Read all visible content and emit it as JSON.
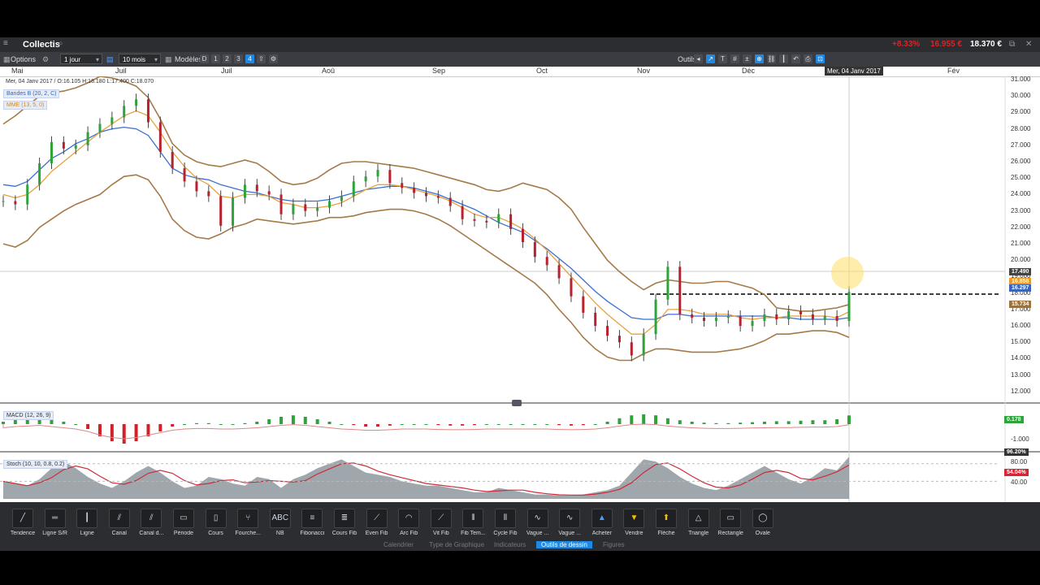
{
  "app": {
    "title": "Collectis",
    "quote": {
      "change": "+8.33%",
      "previous": "16.955 €",
      "last": "18.370 €"
    }
  },
  "toolbar": {
    "options_label": "Options",
    "interval": "1 jour",
    "period": "10 mois",
    "modeles_label": "Modèles",
    "range_buttons": [
      "D",
      "1",
      "2",
      "3",
      "4"
    ],
    "outils_label": "Outils"
  },
  "months": [
    "Mai",
    "Juil",
    "Juil",
    "Aoû",
    "Sep",
    "Oct",
    "Nov",
    "Déc",
    "Fév"
  ],
  "cursor_date": "Mer, 04 Janv 2017",
  "ohlc": "Mer, 04 Janv 2017 / O:16.105 H:18.180 L:17.400 C:18.070",
  "indicators": {
    "bollinger": "Bandes B (20, 2, C)",
    "mme": "MME (13, 5, 0)",
    "macd": "MACD (12, 26, 9)",
    "stoch": "Stoch (10, 10, 0.8, 0.2)"
  },
  "price_axis": [
    "31.000",
    "30.000",
    "29.000",
    "28.000",
    "27.000",
    "26.000",
    "25.000",
    "24.000",
    "23.000",
    "22.000",
    "21.000",
    "20.000",
    "19.000",
    "18.000",
    "17.000",
    "16.000",
    "15.000",
    "14.000",
    "13.000",
    "12.000"
  ],
  "price_tags": {
    "last": "17.490",
    "ema": "16.858",
    "mid": "16.297",
    "lower": "15.734"
  },
  "macd_axis": {
    "value": "0.178",
    "low": "-1.000"
  },
  "stoch_axis": {
    "top": "96.20%",
    "upper": "80.00",
    "value": "54.04%",
    "lower": "40.00"
  },
  "tools": [
    "Tendence",
    "Ligne S/R",
    "Ligne",
    "Canal",
    "Canal d...",
    "Période",
    "Cours",
    "Fourche...",
    "NB",
    "Fibonacci",
    "Cours Fib",
    "Even Fib",
    "Arc Fib",
    "Vit Fib",
    "Fib Tem...",
    "Cycle Fib",
    "Vague ...",
    "Vague ...",
    "Acheter",
    "Vendre",
    "Flèche",
    "Triangle",
    "Rectangle",
    "Ovale"
  ],
  "tool_icons": [
    "trend-line-icon",
    "sr-line-icon",
    "line-icon",
    "channel-icon",
    "channel-d-icon",
    "period-icon",
    "price-icon",
    "pitchfork-icon",
    "text-icon",
    "fibonacci-icon",
    "fib-price-icon",
    "fib-even-icon",
    "fib-arc-icon",
    "fib-speed-icon",
    "fib-time-icon",
    "fib-cycle-icon",
    "wave-icon",
    "wave2-icon",
    "buy-arrow-icon",
    "sell-arrow-icon",
    "arrow-icon",
    "triangle-icon",
    "rectangle-icon",
    "ellipse-icon"
  ],
  "tabs": [
    "Calendrier",
    "Type de Graphique",
    "Indicateurs",
    "Outils de dessin",
    "Figures"
  ],
  "active_tab": "Outils de dessin",
  "chart_data": {
    "type": "candlestick",
    "ylim": [
      11.5,
      31.0
    ],
    "close": [
      23.6,
      23.4,
      24.6,
      25.9,
      27.2,
      26.8,
      27.0,
      27.8,
      28.3,
      28.7,
      29.4,
      29.8,
      28.4,
      26.6,
      25.6,
      24.8,
      24.2,
      23.9,
      22.1,
      23.8,
      24.6,
      24.2,
      24.0,
      22.8,
      23.4,
      23.0,
      23.2,
      23.6,
      23.9,
      24.8,
      25.1,
      25.5,
      24.7,
      24.4,
      24.1,
      23.9,
      23.8,
      23.3,
      22.5,
      22.4,
      22.3,
      22.8,
      21.9,
      21.1,
      20.2,
      19.7,
      18.9,
      17.8,
      16.8,
      16.0,
      15.4,
      15.0,
      14.2,
      15.5,
      17.6,
      19.6,
      16.7,
      16.5,
      16.3,
      16.5,
      16.6,
      16.0,
      16.3,
      16.7,
      16.4,
      16.9,
      16.7,
      16.4,
      16.6,
      16.3,
      18.07
    ],
    "bb_upper": [
      28.3,
      28.8,
      29.4,
      30.0,
      30.2,
      30.3,
      30.5,
      30.8,
      31.2,
      31.1,
      30.9,
      30.6,
      29.9,
      28.6,
      27.1,
      26.4,
      26.0,
      25.8,
      25.7,
      25.9,
      26.1,
      25.9,
      25.4,
      24.8,
      24.6,
      24.7,
      25.0,
      25.5,
      25.9,
      26.0,
      26.0,
      25.9,
      25.8,
      25.7,
      25.6,
      25.4,
      25.2,
      25.0,
      24.8,
      24.6,
      24.3,
      24.2,
      24.4,
      24.7,
      24.5,
      24.3,
      23.8,
      23.1,
      22.0,
      21.0,
      20.0,
      19.3,
      18.7,
      18.2,
      18.6,
      18.8,
      18.7,
      18.6,
      18.6,
      18.7,
      18.7,
      18.5,
      18.3,
      17.9,
      17.1,
      17.0,
      16.9,
      16.9,
      17.0,
      17.1,
      17.3
    ],
    "bb_lower": [
      21.0,
      20.8,
      21.2,
      22.0,
      22.5,
      23.0,
      23.4,
      23.7,
      24.0,
      24.6,
      25.1,
      25.2,
      24.9,
      23.9,
      22.5,
      21.8,
      21.4,
      21.3,
      21.6,
      22.0,
      22.2,
      22.5,
      22.4,
      22.3,
      22.2,
      22.3,
      22.4,
      22.6,
      22.6,
      22.7,
      22.9,
      23.0,
      23.1,
      23.1,
      23.0,
      22.8,
      22.5,
      22.1,
      21.6,
      21.1,
      20.6,
      20.1,
      19.6,
      19.1,
      18.6,
      17.9,
      17.0,
      16.2,
      15.3,
      14.6,
      14.1,
      13.9,
      13.9,
      14.3,
      14.6,
      14.6,
      14.5,
      14.4,
      14.4,
      14.4,
      14.5,
      14.6,
      14.8,
      15.1,
      15.5,
      15.5,
      15.6,
      15.7,
      15.7,
      15.6,
      15.3
    ],
    "bb_mid": [
      24.6,
      24.5,
      24.8,
      25.5,
      26.2,
      26.6,
      27.1,
      27.4,
      27.8,
      28.0,
      28.1,
      28.0,
      27.6,
      26.6,
      25.6,
      25.2,
      25.0,
      24.9,
      24.6,
      24.4,
      24.2,
      24.1,
      23.9,
      23.7,
      23.6,
      23.6,
      23.6,
      23.7,
      23.9,
      24.1,
      24.3,
      24.4,
      24.5,
      24.5,
      24.4,
      24.2,
      24.0,
      23.7,
      23.4,
      23.1,
      22.7,
      22.3,
      22.0,
      21.7,
      21.2,
      20.7,
      20.1,
      19.5,
      18.8,
      18.1,
      17.5,
      17.0,
      16.5,
      16.4,
      16.4,
      16.7,
      16.7,
      16.6,
      16.6,
      16.6,
      16.6,
      16.6,
      16.6,
      16.6,
      16.5,
      16.5,
      16.4,
      16.4,
      16.4,
      16.4,
      16.5
    ],
    "mme": [
      24.0,
      23.8,
      24.0,
      24.6,
      25.4,
      26.0,
      26.6,
      27.2,
      27.8,
      28.3,
      28.8,
      29.1,
      28.8,
      27.8,
      26.6,
      25.7,
      25.0,
      24.6,
      23.9,
      23.8,
      24.0,
      24.0,
      23.9,
      23.5,
      23.4,
      23.2,
      23.2,
      23.3,
      23.5,
      23.9,
      24.3,
      24.6,
      24.6,
      24.5,
      24.3,
      24.1,
      23.9,
      23.6,
      23.2,
      22.8,
      22.6,
      22.6,
      22.3,
      21.9,
      21.3,
      20.6,
      19.8,
      19.0,
      18.2,
      17.4,
      16.7,
      16.1,
      15.5,
      15.5,
      16.1,
      17.0,
      17.0,
      16.9,
      16.7,
      16.7,
      16.7,
      16.5,
      16.4,
      16.5,
      16.5,
      16.6,
      16.6,
      16.6,
      16.6,
      16.5,
      16.86
    ],
    "macd_hist": [
      0.05,
      0.1,
      0.12,
      0.15,
      0.1,
      0.05,
      0.0,
      -0.1,
      -0.25,
      -0.35,
      -0.4,
      -0.35,
      -0.25,
      -0.15,
      -0.05,
      0.0,
      0.02,
      0.02,
      0.0,
      0.0,
      0.02,
      0.05,
      0.1,
      0.15,
      0.18,
      0.15,
      0.1,
      0.05,
      0.0,
      -0.02,
      -0.05,
      -0.05,
      -0.03,
      0.0,
      0.0,
      0.0,
      -0.02,
      -0.03,
      -0.03,
      -0.02,
      0.0,
      0.0,
      0.0,
      0.0,
      0.0,
      0.0,
      -0.02,
      -0.03,
      -0.02,
      0.0,
      0.05,
      0.12,
      0.18,
      0.2,
      0.18,
      0.12,
      0.08,
      0.05,
      0.03,
      0.02,
      0.02,
      0.03,
      0.04,
      0.05,
      0.06,
      0.06,
      0.07,
      0.08,
      0.08,
      0.1,
      0.178
    ],
    "stoch": [
      40,
      35,
      30,
      45,
      70,
      85,
      70,
      50,
      35,
      25,
      40,
      60,
      75,
      60,
      40,
      25,
      30,
      50,
      45,
      35,
      30,
      50,
      45,
      25,
      45,
      55,
      70,
      80,
      90,
      75,
      60,
      55,
      50,
      40,
      35,
      30,
      30,
      25,
      20,
      15,
      15,
      25,
      20,
      15,
      10,
      10,
      8,
      8,
      10,
      15,
      20,
      30,
      60,
      90,
      85,
      70,
      50,
      35,
      25,
      20,
      30,
      45,
      60,
      75,
      60,
      45,
      35,
      50,
      70,
      65,
      96
    ]
  }
}
